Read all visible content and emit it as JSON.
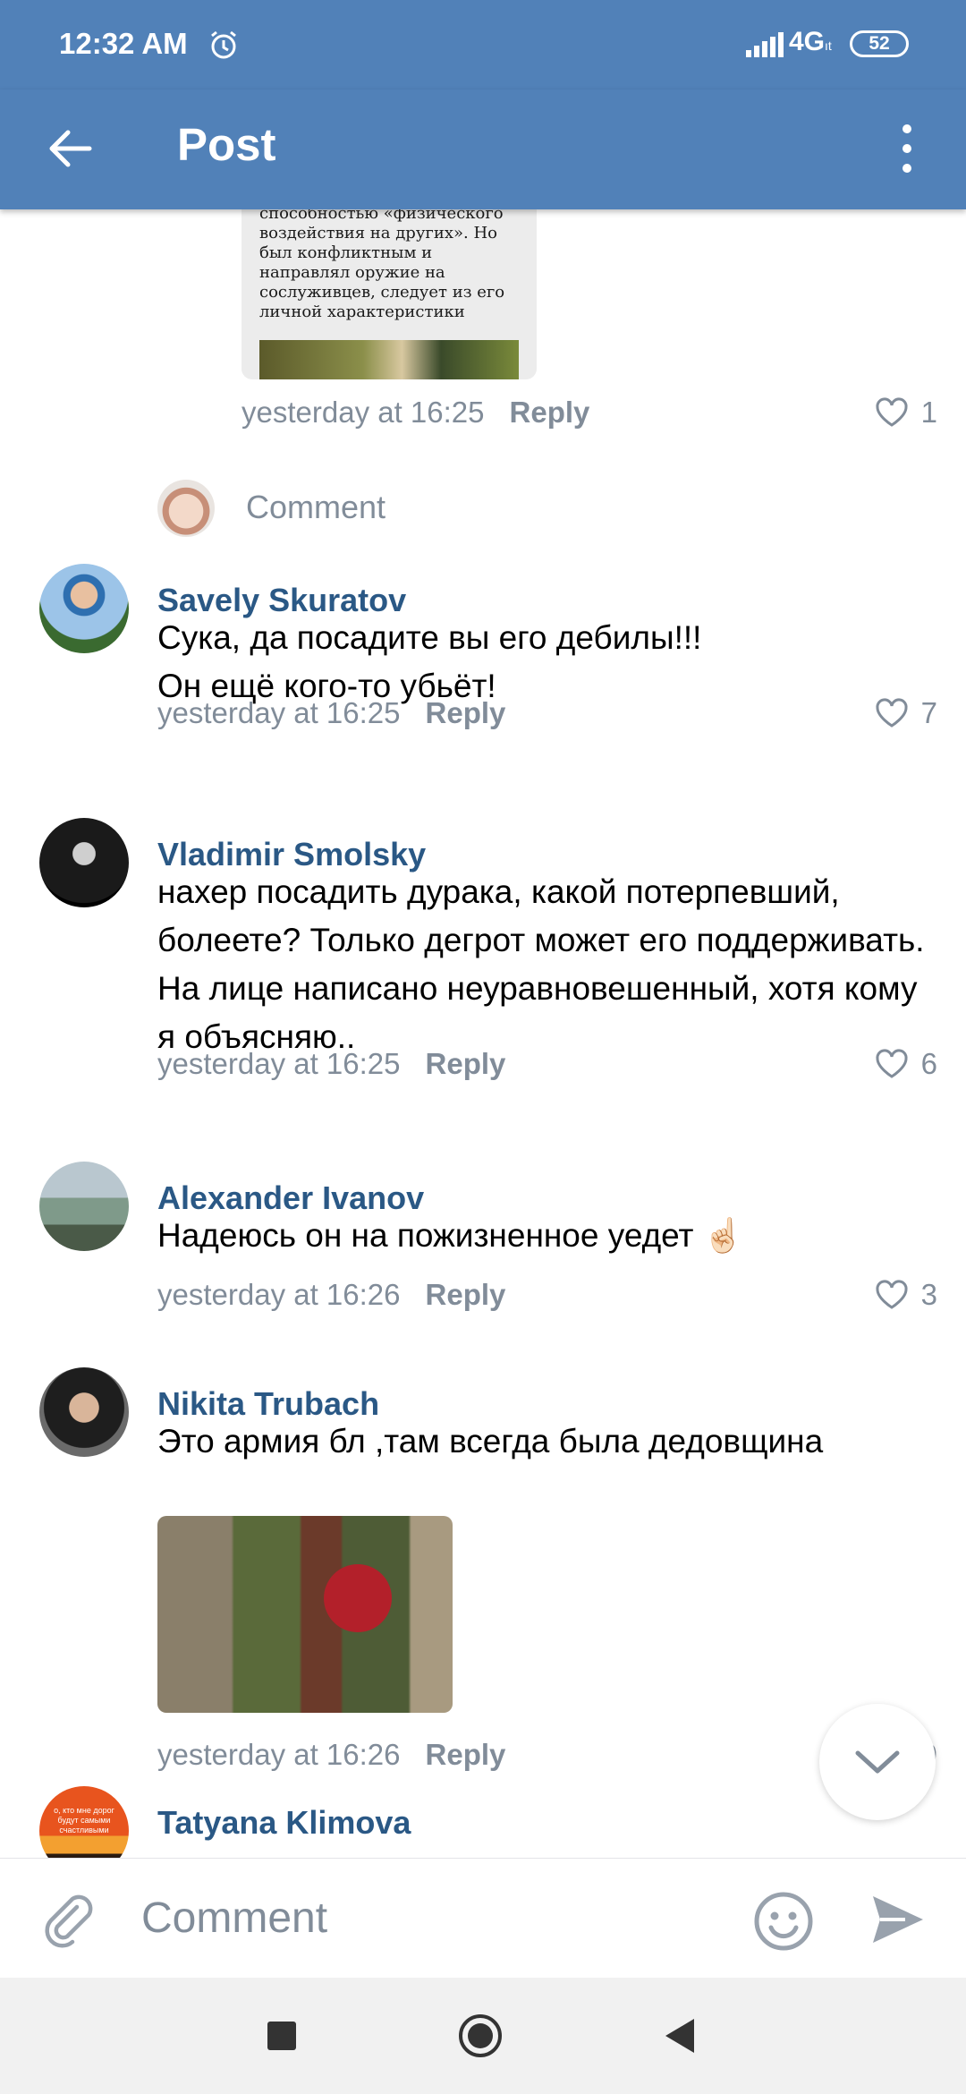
{
  "status_bar": {
    "time": "12:32 AM",
    "network": "4G",
    "network_sub": "ıt",
    "battery": "52"
  },
  "app_bar": {
    "title": "Post",
    "back_icon": "arrow-left-icon",
    "more_icon": "more-vertical-icon"
  },
  "previous_reply": {
    "image_text": "способностью «физического\nвоздействия на других». Но\nбыл конфликтным и\nнаправлял оружие на\nсослуживцев, следует из его\nличной характеристики",
    "time": "yesterday at 16:25",
    "reply_label": "Reply",
    "likes": "1"
  },
  "reply_prompt": {
    "placeholder": "Comment"
  },
  "comments": [
    {
      "author": "Savely Skuratov",
      "text": "Сука, да посадите вы его дебилы!!!\nОн ещё кого-то убьёт!",
      "time": "yesterday at 16:25",
      "reply_label": "Reply",
      "likes": "7"
    },
    {
      "author": "Vladimir Smolsky",
      "text": "нахер посадить дурака, какой потерпевший, болеете? Только дегрот может его поддерживать. На лице написано неуравновешенный, хотя кому я объясняю..",
      "time": "yesterday at 16:25",
      "reply_label": "Reply",
      "likes": "6"
    },
    {
      "author": "Alexander Ivanov",
      "text": "Надеюсь он на пожизненное уедет ☝🏻",
      "time": "yesterday at 16:26",
      "reply_label": "Reply",
      "likes": "3"
    },
    {
      "author": "Nikita Trubach",
      "text": "Это армия бл ,там всегда была дедовщина",
      "time": "yesterday at 16:26",
      "reply_label": "Reply",
      "likes": "9"
    },
    {
      "author": "Tatyana Klimova",
      "text": "",
      "avatar_text": "о, кто мне дорог будут самыми счастливыми"
    }
  ],
  "compose": {
    "placeholder": "Comment"
  },
  "colors": {
    "accent": "#5181b8",
    "name": "#2a5885",
    "meta": "#818c99"
  }
}
